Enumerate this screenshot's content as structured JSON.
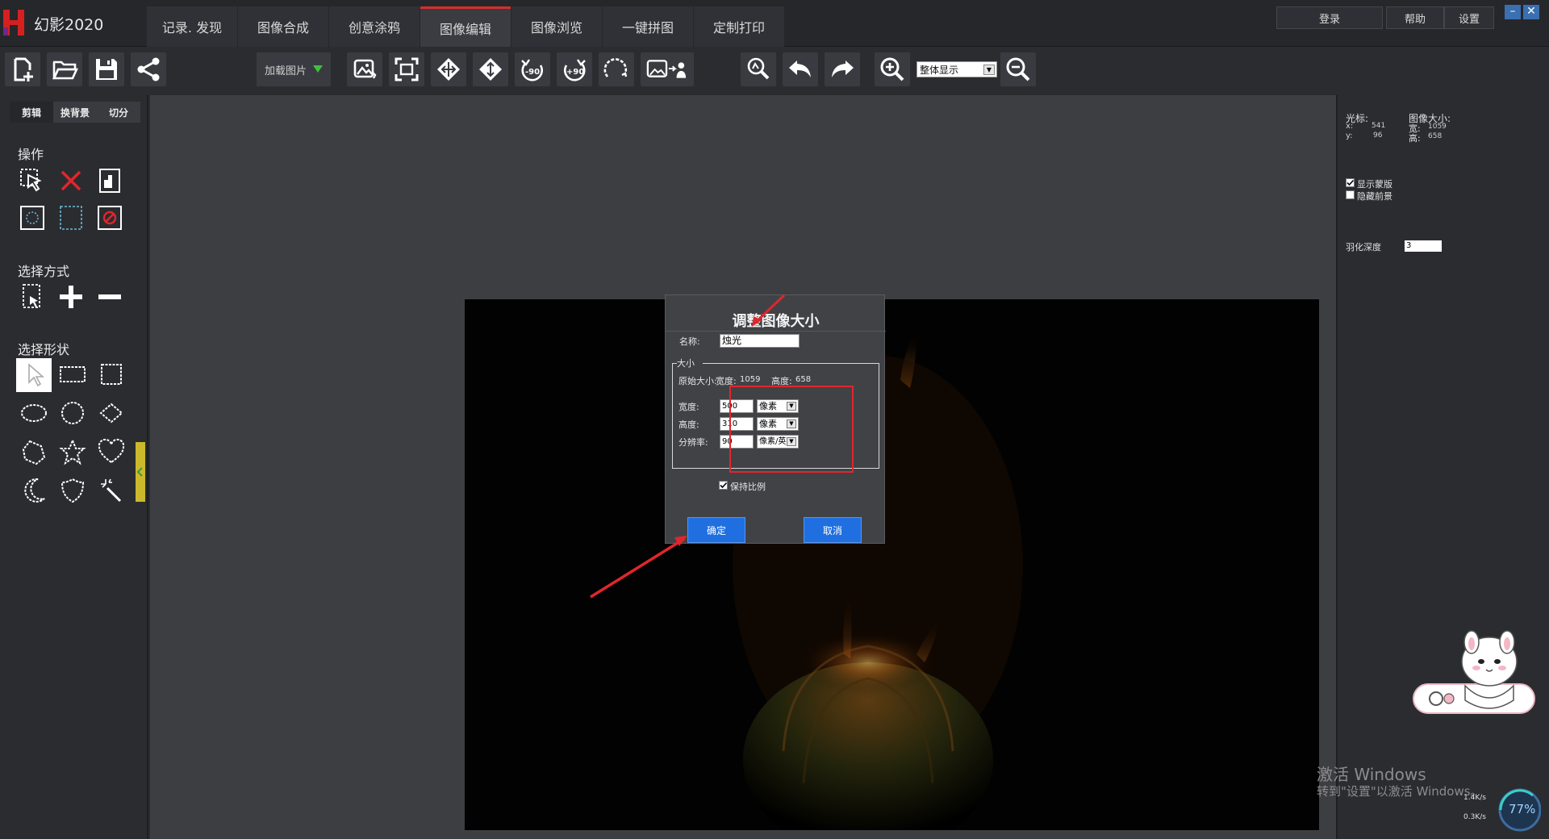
{
  "app": {
    "title": "幻影2020"
  },
  "tabs": [
    {
      "label": "记录. 发现",
      "active": false
    },
    {
      "label": "图像合成",
      "active": false
    },
    {
      "label": "创意涂鸦",
      "active": false
    },
    {
      "label": "图像编辑",
      "active": true
    },
    {
      "label": "图像浏览",
      "active": false
    },
    {
      "label": "一键拼图",
      "active": false
    },
    {
      "label": "定制打印",
      "active": false
    }
  ],
  "top_right": {
    "login": "登录",
    "help": "帮助",
    "settings": "设置"
  },
  "toolbar": {
    "load_image": "加载图片",
    "zoom_mode": "整体显示"
  },
  "left_panel": {
    "tabs": [
      "剪辑",
      "换背景",
      "切分"
    ],
    "operations_title": "操作",
    "select_mode_title": "选择方式",
    "select_shape_title": "选择形状"
  },
  "right_panel": {
    "cursor_label": "光标:",
    "x_label": "x:",
    "x_value": "541",
    "y_label": "y:",
    "y_value": "96",
    "image_size_label": "图像大小:",
    "width_label": "宽:",
    "width_value": "1059",
    "height_label": "高:",
    "height_value": "658",
    "show_mask": "显示蒙版",
    "show_mask_checked": true,
    "hide_foreground": "隐藏前景",
    "hide_foreground_checked": false,
    "feather_label": "羽化深度",
    "feather_value": "3"
  },
  "dialog": {
    "title": "调整图像大小",
    "name_label": "名称:",
    "name_value": "烛光",
    "size_group": "大小",
    "original_size_label": "原始大小:",
    "orig_width_label": "宽度:",
    "orig_width": "1059",
    "orig_height_label": "高度:",
    "orig_height": "658",
    "width_label": "宽度:",
    "width_value": "500",
    "width_unit": "像素",
    "height_label": "高度:",
    "height_value": "310",
    "height_unit": "像素",
    "resolution_label": "分辨率:",
    "resolution_value": "90",
    "resolution_unit": "像素/英",
    "keep_ratio": "保持比例",
    "keep_ratio_checked": true,
    "ok": "确定",
    "cancel": "取消"
  },
  "watermark": {
    "line1": "激活 Windows",
    "line2": "转到\"设置\"以激活 Windows。"
  },
  "net_widget": {
    "up": "1.4K/s",
    "down": "0.3K/s",
    "percent": "77%"
  },
  "colors": {
    "accent_red": "#e0262c",
    "button_blue": "#1f6fe0",
    "active_tab_marker": "#d4302b"
  }
}
